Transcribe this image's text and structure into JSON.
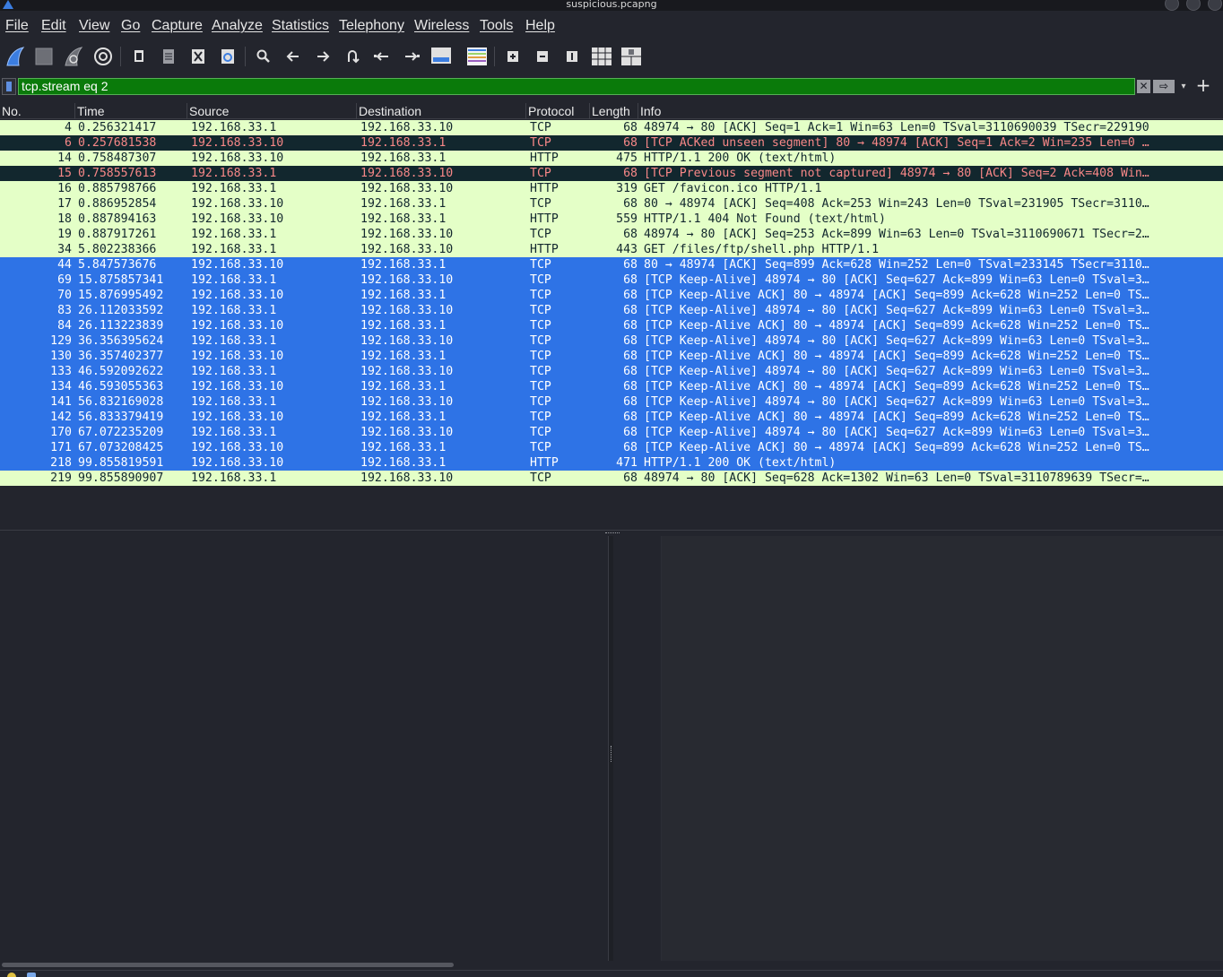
{
  "window": {
    "title": "suspicious.pcapng"
  },
  "menu": [
    "File",
    "Edit",
    "View",
    "Go",
    "Capture",
    "Analyze",
    "Statistics",
    "Telephony",
    "Wireless",
    "Tools",
    "Help"
  ],
  "toolbar_icons": [
    "start-capture-icon",
    "stop-capture-icon",
    "restart-capture-icon",
    "capture-options-icon",
    "open-file-icon",
    "save-file-icon",
    "close-file-icon",
    "reload-file-icon",
    "find-packet-icon",
    "go-back-icon",
    "go-forward-icon",
    "go-to-packet-icon",
    "first-packet-icon",
    "last-packet-icon",
    "autoscroll-icon",
    "colorize-icon",
    "zoom-in-icon",
    "zoom-out-icon",
    "normal-size-icon",
    "resize-columns-icon",
    "layout-icon"
  ],
  "filter": {
    "value": "tcp.stream eq 2",
    "clear_glyph": "✕",
    "apply_glyph": "⇨",
    "recent_glyph": "▾",
    "add_glyph": "+"
  },
  "columns": [
    "No.",
    "Time",
    "Source",
    "Destination",
    "Protocol",
    "Length",
    "Info"
  ],
  "colors": {
    "normal_bg": "#e4ffc7",
    "bad_bg": "#12272e",
    "bad_fg": "#f78787",
    "selected_bg": "#2e73e6",
    "filter_valid": "#0a7a0a"
  },
  "packets": [
    {
      "no": "4",
      "time": "0.256321417",
      "src": "192.168.33.1",
      "dst": "192.168.33.10",
      "proto": "TCP",
      "len": "68",
      "info": "48974 → 80 [ACK] Seq=1 Ack=1 Win=63 Len=0 TSval=3110690039 TSecr=229190",
      "style": "normal"
    },
    {
      "no": "6",
      "time": "0.257681538",
      "src": "192.168.33.10",
      "dst": "192.168.33.1",
      "proto": "TCP",
      "len": "68",
      "info": "[TCP ACKed unseen segment] 80 → 48974 [ACK] Seq=1 Ack=2 Win=235 Len=0 …",
      "style": "bad"
    },
    {
      "no": "14",
      "time": "0.758487307",
      "src": "192.168.33.10",
      "dst": "192.168.33.1",
      "proto": "HTTP",
      "len": "475",
      "info": "HTTP/1.1 200 OK  (text/html)",
      "style": "normal"
    },
    {
      "no": "15",
      "time": "0.758557613",
      "src": "192.168.33.1",
      "dst": "192.168.33.10",
      "proto": "TCP",
      "len": "68",
      "info": "[TCP Previous segment not captured] 48974 → 80 [ACK] Seq=2 Ack=408 Win…",
      "style": "bad"
    },
    {
      "no": "16",
      "time": "0.885798766",
      "src": "192.168.33.1",
      "dst": "192.168.33.10",
      "proto": "HTTP",
      "len": "319",
      "info": "GET /favicon.ico HTTP/1.1",
      "style": "normal"
    },
    {
      "no": "17",
      "time": "0.886952854",
      "src": "192.168.33.10",
      "dst": "192.168.33.1",
      "proto": "TCP",
      "len": "68",
      "info": "80 → 48974 [ACK] Seq=408 Ack=253 Win=243 Len=0 TSval=231905 TSecr=3110…",
      "style": "normal"
    },
    {
      "no": "18",
      "time": "0.887894163",
      "src": "192.168.33.10",
      "dst": "192.168.33.1",
      "proto": "HTTP",
      "len": "559",
      "info": "HTTP/1.1 404 Not Found  (text/html)",
      "style": "normal"
    },
    {
      "no": "19",
      "time": "0.887917261",
      "src": "192.168.33.1",
      "dst": "192.168.33.10",
      "proto": "TCP",
      "len": "68",
      "info": "48974 → 80 [ACK] Seq=253 Ack=899 Win=63 Len=0 TSval=3110690671 TSecr=2…",
      "style": "normal"
    },
    {
      "no": "34",
      "time": "5.802238366",
      "src": "192.168.33.1",
      "dst": "192.168.33.10",
      "proto": "HTTP",
      "len": "443",
      "info": "GET /files/ftp/shell.php HTTP/1.1",
      "style": "normal"
    },
    {
      "no": "44",
      "time": "5.847573676",
      "src": "192.168.33.10",
      "dst": "192.168.33.1",
      "proto": "TCP",
      "len": "68",
      "info": "80 → 48974 [ACK] Seq=899 Ack=628 Win=252 Len=0 TSval=233145 TSecr=3110…",
      "style": "selected"
    },
    {
      "no": "69",
      "time": "15.875857341",
      "src": "192.168.33.1",
      "dst": "192.168.33.10",
      "proto": "TCP",
      "len": "68",
      "info": "[TCP Keep-Alive] 48974 → 80 [ACK] Seq=627 Ack=899 Win=63 Len=0 TSval=3…",
      "style": "selected"
    },
    {
      "no": "70",
      "time": "15.876995492",
      "src": "192.168.33.10",
      "dst": "192.168.33.1",
      "proto": "TCP",
      "len": "68",
      "info": "[TCP Keep-Alive ACK] 80 → 48974 [ACK] Seq=899 Ack=628 Win=252 Len=0 TS…",
      "style": "selected"
    },
    {
      "no": "83",
      "time": "26.112033592",
      "src": "192.168.33.1",
      "dst": "192.168.33.10",
      "proto": "TCP",
      "len": "68",
      "info": "[TCP Keep-Alive] 48974 → 80 [ACK] Seq=627 Ack=899 Win=63 Len=0 TSval=3…",
      "style": "selected"
    },
    {
      "no": "84",
      "time": "26.113223839",
      "src": "192.168.33.10",
      "dst": "192.168.33.1",
      "proto": "TCP",
      "len": "68",
      "info": "[TCP Keep-Alive ACK] 80 → 48974 [ACK] Seq=899 Ack=628 Win=252 Len=0 TS…",
      "style": "selected"
    },
    {
      "no": "129",
      "time": "36.356395624",
      "src": "192.168.33.1",
      "dst": "192.168.33.10",
      "proto": "TCP",
      "len": "68",
      "info": "[TCP Keep-Alive] 48974 → 80 [ACK] Seq=627 Ack=899 Win=63 Len=0 TSval=3…",
      "style": "selected"
    },
    {
      "no": "130",
      "time": "36.357402377",
      "src": "192.168.33.10",
      "dst": "192.168.33.1",
      "proto": "TCP",
      "len": "68",
      "info": "[TCP Keep-Alive ACK] 80 → 48974 [ACK] Seq=899 Ack=628 Win=252 Len=0 TS…",
      "style": "selected"
    },
    {
      "no": "133",
      "time": "46.592092622",
      "src": "192.168.33.1",
      "dst": "192.168.33.10",
      "proto": "TCP",
      "len": "68",
      "info": "[TCP Keep-Alive] 48974 → 80 [ACK] Seq=627 Ack=899 Win=63 Len=0 TSval=3…",
      "style": "selected"
    },
    {
      "no": "134",
      "time": "46.593055363",
      "src": "192.168.33.10",
      "dst": "192.168.33.1",
      "proto": "TCP",
      "len": "68",
      "info": "[TCP Keep-Alive ACK] 80 → 48974 [ACK] Seq=899 Ack=628 Win=252 Len=0 TS…",
      "style": "selected"
    },
    {
      "no": "141",
      "time": "56.832169028",
      "src": "192.168.33.1",
      "dst": "192.168.33.10",
      "proto": "TCP",
      "len": "68",
      "info": "[TCP Keep-Alive] 48974 → 80 [ACK] Seq=627 Ack=899 Win=63 Len=0 TSval=3…",
      "style": "selected"
    },
    {
      "no": "142",
      "time": "56.833379419",
      "src": "192.168.33.10",
      "dst": "192.168.33.1",
      "proto": "TCP",
      "len": "68",
      "info": "[TCP Keep-Alive ACK] 80 → 48974 [ACK] Seq=899 Ack=628 Win=252 Len=0 TS…",
      "style": "selected"
    },
    {
      "no": "170",
      "time": "67.072235209",
      "src": "192.168.33.1",
      "dst": "192.168.33.10",
      "proto": "TCP",
      "len": "68",
      "info": "[TCP Keep-Alive] 48974 → 80 [ACK] Seq=627 Ack=899 Win=63 Len=0 TSval=3…",
      "style": "selected"
    },
    {
      "no": "171",
      "time": "67.073208425",
      "src": "192.168.33.10",
      "dst": "192.168.33.1",
      "proto": "TCP",
      "len": "68",
      "info": "[TCP Keep-Alive ACK] 80 → 48974 [ACK] Seq=899 Ack=628 Win=252 Len=0 TS…",
      "style": "selected"
    },
    {
      "no": "218",
      "time": "99.855819591",
      "src": "192.168.33.10",
      "dst": "192.168.33.1",
      "proto": "HTTP",
      "len": "471",
      "info": "HTTP/1.1 200 OK  (text/html)",
      "style": "selected"
    },
    {
      "no": "219",
      "time": "99.855890907",
      "src": "192.168.33.1",
      "dst": "192.168.33.10",
      "proto": "TCP",
      "len": "68",
      "info": "48974 → 80 [ACK] Seq=628 Ack=1302 Win=63 Len=0 TSval=3110789639 TSecr=…",
      "style": "normal"
    }
  ]
}
